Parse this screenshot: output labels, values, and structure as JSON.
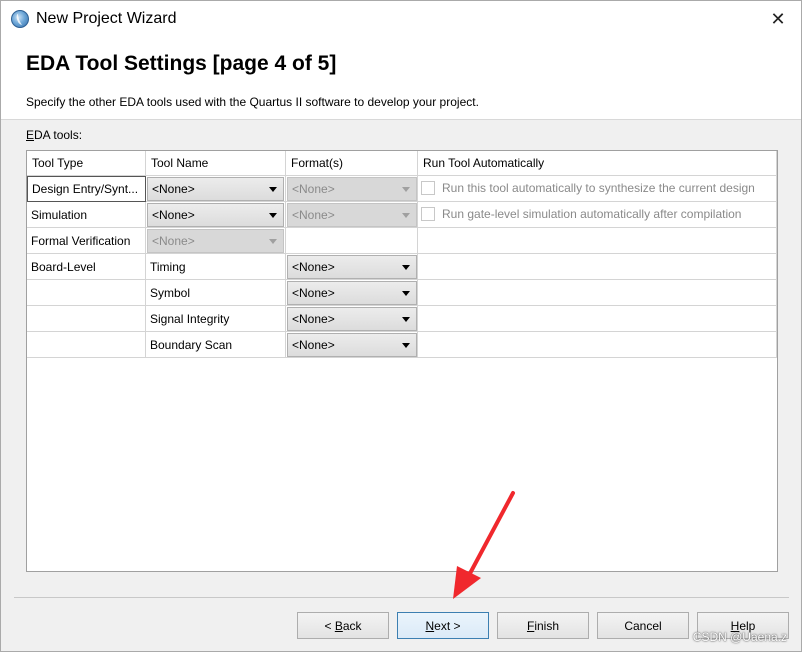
{
  "window": {
    "title": "New Project Wizard",
    "close_glyph": "✕"
  },
  "header": {
    "heading": "EDA Tool Settings [page 4 of 5]",
    "description": "Specify the other EDA tools used with the Quartus II software to develop your project."
  },
  "eda_tools_label": {
    "mnemonic": "E",
    "rest": "DA tools:"
  },
  "table": {
    "columns": [
      "Tool Type",
      "Tool Name",
      "Format(s)",
      "Run Tool Automatically"
    ],
    "rows": [
      {
        "type": "Design Entry/Synt...",
        "name": "<None>",
        "format": "<None>",
        "run": "Run this tool automatically to synthesize the current design"
      },
      {
        "type": "Simulation",
        "name": "<None>",
        "format": "<None>",
        "run": "Run gate-level simulation automatically after compilation"
      },
      {
        "type": "Formal Verification",
        "name": "<None>"
      },
      {
        "type": "Board-Level",
        "name": "Timing",
        "format": "<None>"
      },
      {
        "type": "",
        "name": "Symbol",
        "format": "<None>"
      },
      {
        "type": "",
        "name": "Signal Integrity",
        "format": "<None>"
      },
      {
        "type": "",
        "name": "Boundary Scan",
        "format": "<None>"
      }
    ]
  },
  "buttons": {
    "back": {
      "prefix": "< ",
      "mnemonic": "B",
      "rest": "ack"
    },
    "next": {
      "mnemonic": "N",
      "rest": "ext >"
    },
    "finish": {
      "mnemonic": "F",
      "rest": "inish"
    },
    "cancel": "Cancel",
    "help": {
      "mnemonic": "H",
      "rest": "elp"
    }
  },
  "watermark": "CSDN @Uaena.z",
  "colors": {
    "annotation_arrow": "#f0282d",
    "default_button_border": "#3c7fb1"
  }
}
